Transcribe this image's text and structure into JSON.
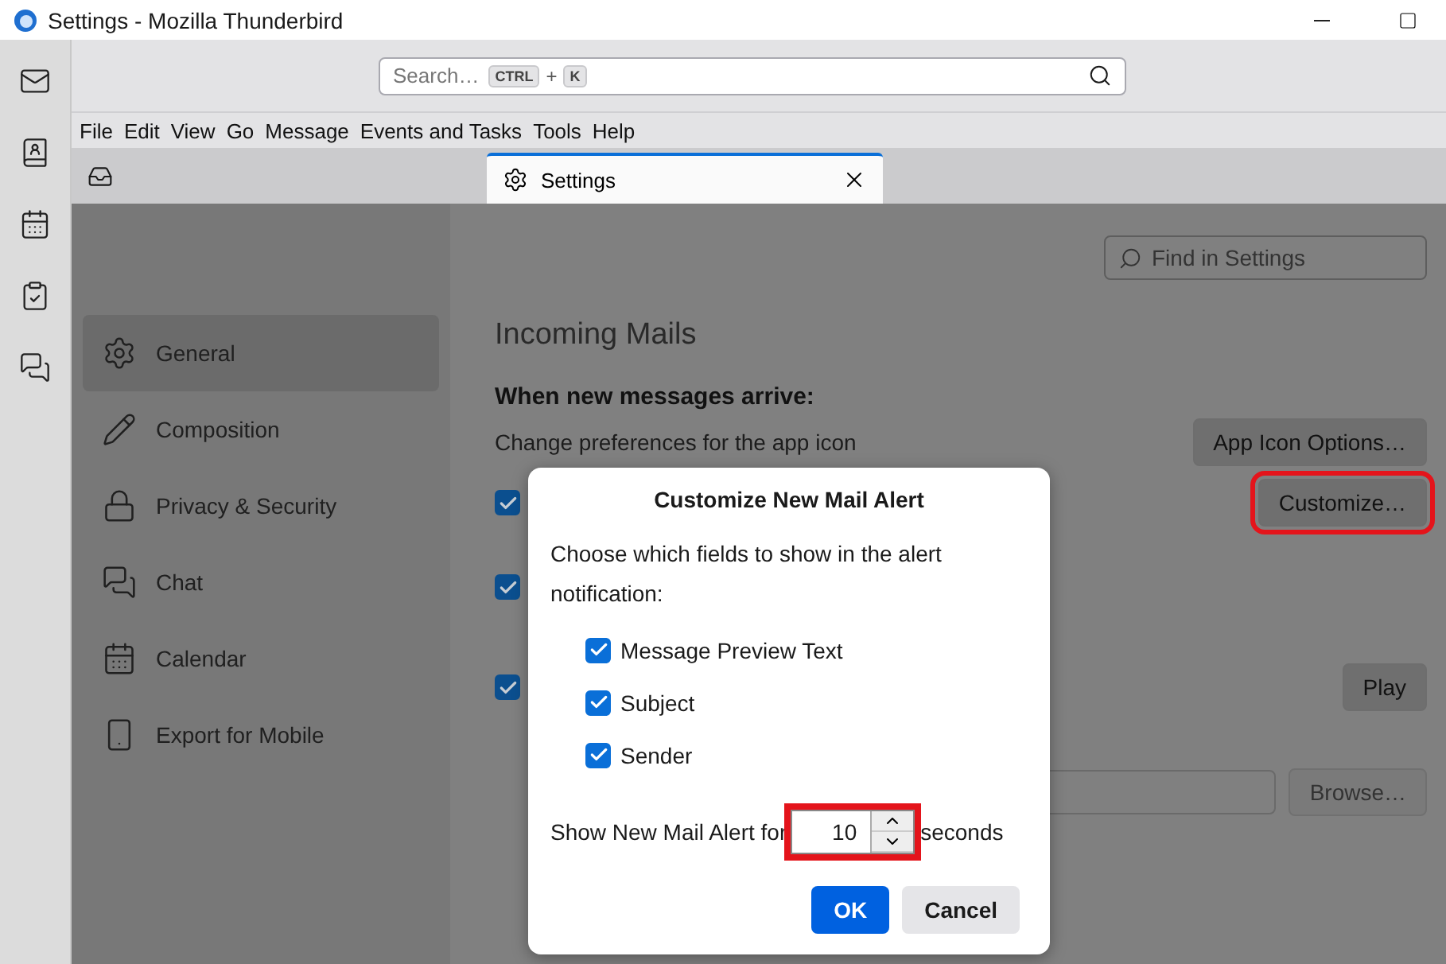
{
  "window": {
    "title": "Settings - Mozilla Thunderbird"
  },
  "search": {
    "placeholder": "Search…",
    "keys": [
      "CTRL",
      "K"
    ],
    "joiner": "+"
  },
  "menu": [
    "File",
    "Edit",
    "View",
    "Go",
    "Message",
    "Events and Tasks",
    "Tools",
    "Help"
  ],
  "tabs": [
    {
      "label": "Settings",
      "selected": true
    }
  ],
  "find": {
    "placeholder": "Find in Settings"
  },
  "nav": [
    {
      "kind": "gear",
      "label": "General",
      "selected": true
    },
    {
      "kind": "pencil",
      "label": "Composition",
      "selected": false
    },
    {
      "kind": "lock",
      "label": "Privacy & Security",
      "selected": false
    },
    {
      "kind": "chat",
      "label": "Chat",
      "selected": false
    },
    {
      "kind": "calendar",
      "label": "Calendar",
      "selected": false
    },
    {
      "kind": "mobile",
      "label": "Export for Mobile",
      "selected": false
    }
  ],
  "section": {
    "title": "Incoming Mails",
    "subtitle": "When new messages arrive:",
    "app_icon_text": "Change preferences for the app icon",
    "app_icon_button": "App Icon Options…"
  },
  "options": [
    {
      "checked": true,
      "button": {
        "label": "Customize…",
        "highlighted": true
      }
    },
    {
      "checked": true
    },
    {
      "checked": true,
      "button": {
        "label": "Play",
        "highlighted": false
      }
    }
  ],
  "sound_file": {
    "button": "Browse…",
    "disabled": true
  },
  "dialog": {
    "title": "Customize New Mail Alert",
    "text": "Choose which fields to show in the alert notification:",
    "fields": [
      {
        "label": "Message Preview Text",
        "checked": true
      },
      {
        "label": "Subject",
        "checked": true
      },
      {
        "label": "Sender",
        "checked": true
      }
    ],
    "duration_label": "Show New Mail Alert for",
    "duration_value": "10",
    "duration_highlighted": true,
    "duration_unit": "seconds",
    "ok": "OK",
    "cancel": "Cancel"
  }
}
